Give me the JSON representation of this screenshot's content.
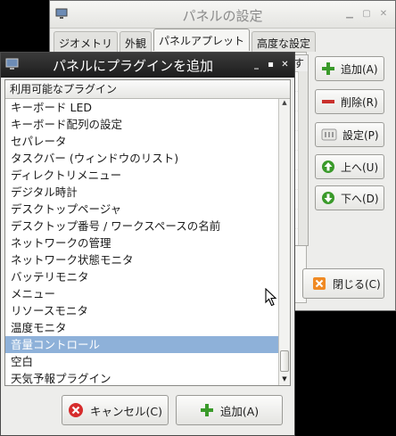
{
  "back_window": {
    "title": "パネルの設定",
    "tabs": [
      "ジオメトリ",
      "外観",
      "パネルアプレット",
      "高度な設定"
    ],
    "list_header_fragment": "す",
    "buttons": {
      "add": "追加(A)",
      "remove": "削除(R)",
      "settings": "設定(P)",
      "up": "上へ(U)",
      "down": "下へ(D)",
      "close": "閉じる(C)"
    }
  },
  "dialog": {
    "title": "パネルにプラグインを追加",
    "list_header": "利用可能なプラグイン",
    "plugins": [
      "キーボード LED",
      "キーボード配列の設定",
      "セパレータ",
      "タスクバー (ウィンドウのリスト)",
      "ディレクトリメニュー",
      "デジタル時計",
      "デスクトップページャ",
      "デスクトップ番号 / ワークスペースの名前",
      "ネットワークの管理",
      "ネットワーク状態モニタ",
      "バッテリモニタ",
      "メニュー",
      "リソースモニタ",
      "温度モニタ",
      "音量コントロール",
      "空白",
      "天気予報プラグイン"
    ],
    "selected_index": 14,
    "cancel_label": "キャンセル(C)",
    "add_label": "追加(A)"
  },
  "colors": {
    "selection": "#8eb1d9",
    "dialog_titlebar": "#2a2a2a",
    "green_icon": "#3a9a2a",
    "red_icon": "#c9302c"
  }
}
